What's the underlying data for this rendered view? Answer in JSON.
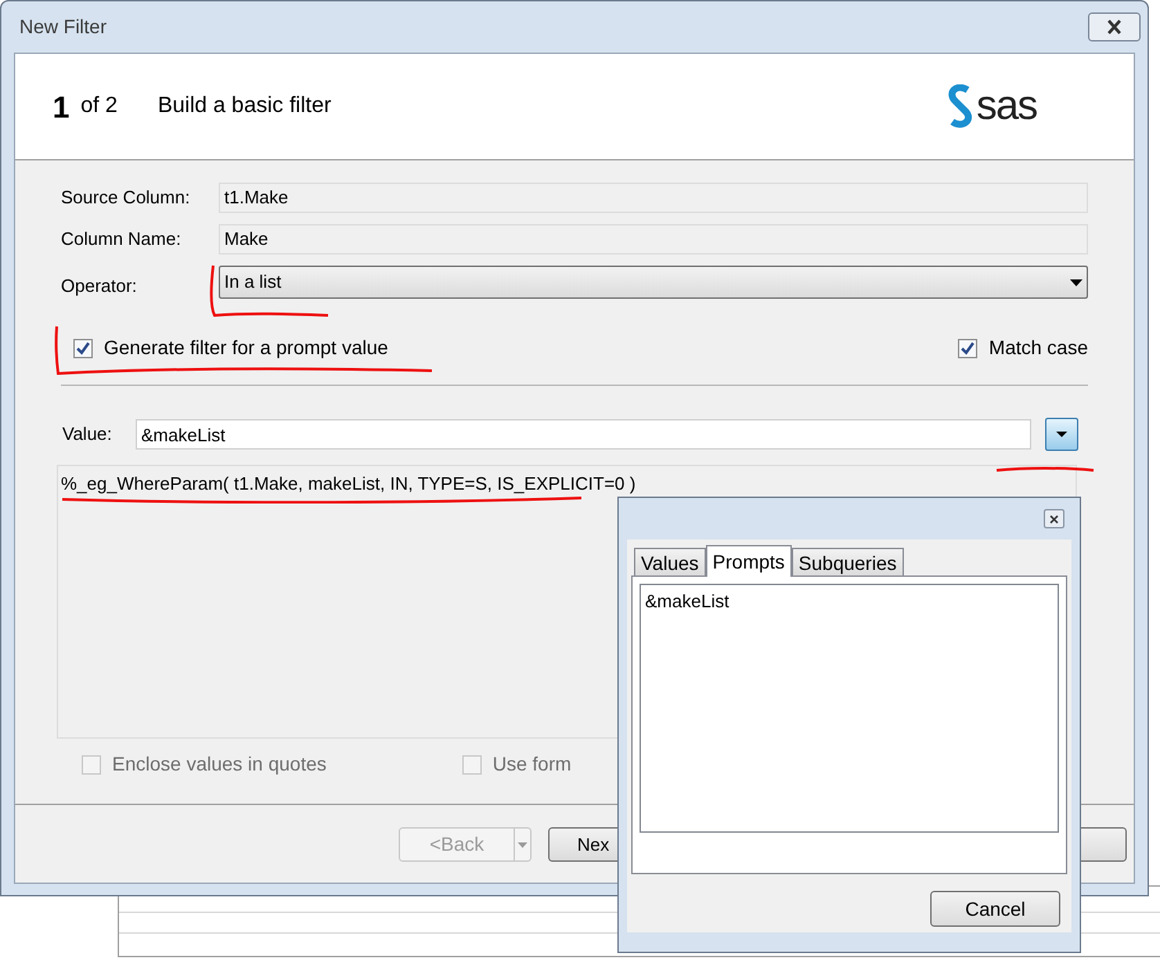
{
  "window": {
    "title": "New Filter"
  },
  "header": {
    "step": "1",
    "of": "of 2",
    "title": "Build a basic filter",
    "logo": "sas"
  },
  "fields": [
    {
      "label": "Source Column:",
      "value": "t1.Make"
    },
    {
      "label": "Column Name:",
      "value": "Make"
    }
  ],
  "operator": {
    "label": "Operator:",
    "value": "In a list"
  },
  "options": [
    {
      "label": "Generate filter for a prompt value",
      "checked": true,
      "disabled": false
    },
    {
      "label": "Match case",
      "checked": true,
      "disabled": false
    }
  ],
  "value": {
    "label": "Value:",
    "value": "&makeList"
  },
  "expression": "%_eg_WhereParam( t1.Make, makeList, IN, TYPE=S, IS_EXPLICIT=0 )",
  "bottom_options": [
    {
      "label": "Enclose values in quotes",
      "checked": false,
      "disabled": true
    },
    {
      "label": "Use form",
      "checked": false,
      "disabled": true
    }
  ],
  "buttons": [
    {
      "label": "<Back",
      "disabled": true
    },
    {
      "label": "Nex",
      "disabled": false
    }
  ],
  "popup": {
    "tabs": [
      {
        "label": "Values",
        "selected": false
      },
      {
        "label": "Prompts",
        "selected": true
      },
      {
        "label": "Subqueries",
        "selected": false
      }
    ],
    "items": [
      "&makeList"
    ],
    "cancel": "Cancel"
  }
}
